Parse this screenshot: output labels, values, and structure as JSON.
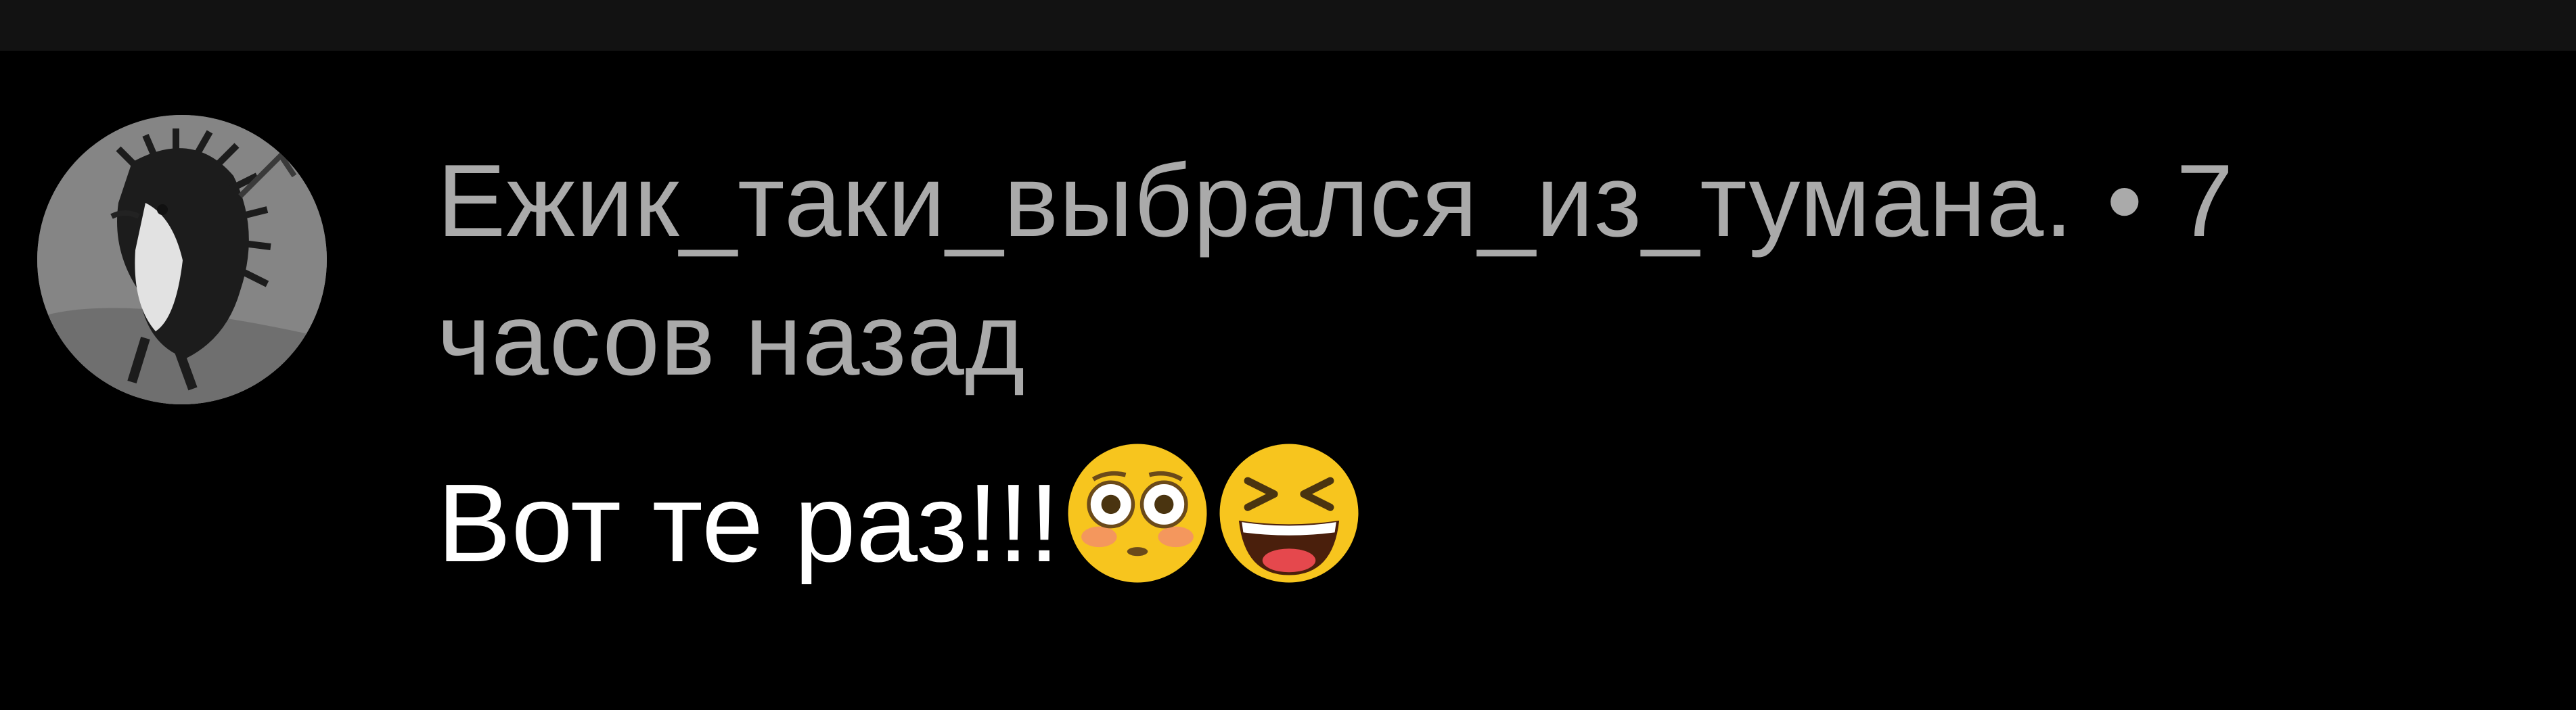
{
  "comment": {
    "author": "Ежик_таки_выбрался_из_тумана.",
    "separator": "•",
    "time": "7 часов назад",
    "text": "Вот те раз!!!",
    "emojis": [
      "flushed-face-icon",
      "grinning-squinting-face-icon"
    ]
  },
  "colors": {
    "background": "#000000",
    "status_bar": "#121212",
    "meta_text": "#aaaaaa",
    "body_text": "#ffffff",
    "emoji_face": "#f7c51e"
  }
}
